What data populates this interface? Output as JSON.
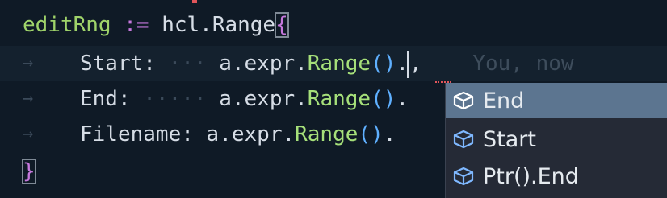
{
  "code": {
    "line1": {
      "ident": "editRng",
      "op": ":=",
      "pkg": "hcl.Range",
      "brace": "{"
    },
    "line2": {
      "field": "Start:",
      "ws": "···",
      "recv": "a.expr.",
      "fn": "Range",
      "open_paren": "(",
      "close_paren": ")",
      "dot": ".",
      "comma": ",",
      "ghost": "You, now"
    },
    "line3": {
      "field": "End:",
      "ws": "·····",
      "recv": "a.expr.",
      "fn": "Range",
      "open_paren": "(",
      "close_paren": ")",
      "dot": "."
    },
    "line4": {
      "field": "Filename:",
      "recv": "a.expr.",
      "fn": "Range",
      "open_paren": "(",
      "close_paren": ")",
      "dot": "."
    },
    "line5": {
      "brace": "}"
    },
    "indent_glyph": "→"
  },
  "suggestions": [
    {
      "label": "End",
      "icon": "field-cube-icon",
      "selected": true
    },
    {
      "label": "Start",
      "icon": "field-cube-icon",
      "selected": false
    },
    {
      "label": "Ptr().End",
      "icon": "field-cube-icon",
      "selected": false
    }
  ],
  "colors": {
    "background": "#0f1a26",
    "identifier": "#9fd36a",
    "operator": "#c678dd",
    "function": "#a6e07a",
    "paren": "#5fb0ff",
    "suggest_bg": "#252a36",
    "suggest_selected": "#5c7590",
    "icon_blue": "#7fb8ff"
  }
}
